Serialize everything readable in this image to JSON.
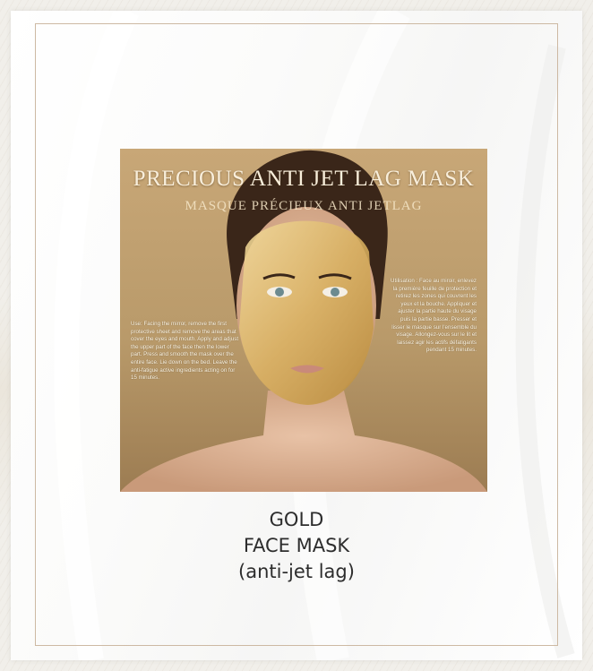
{
  "product_image": {
    "title": "PRECIOUS ANTI JET LAG MASK",
    "subtitle": "MASQUE PRÉCIEUX ANTI JETLAG",
    "instructions_en": "Use: Facing the mirror, remove the first protective sheet and remove the areas that cover the eyes and mouth. Apply and adjust the upper part of the face then the lower part. Press and smooth the mask over the entire face. Lie down on the bed. Leave the anti-fatigue active ingredients acting on for 15 minutes.",
    "instructions_fr": "Utilisation : Face au miroir, enlevez la première feuille de protection et retirez les zones qui couvrent les yeux et la bouche. Appliquer et ajuster la partie haute du visage puis la partie basse. Presser et lisser le masque sur l'ensemble du visage. Allongez-vous sur le lit et laissez agir les actifs défatigants pendant 15 minutes."
  },
  "caption": {
    "line1": "GOLD",
    "line2": "FACE MASK",
    "line3": "(anti-jet lag)"
  }
}
